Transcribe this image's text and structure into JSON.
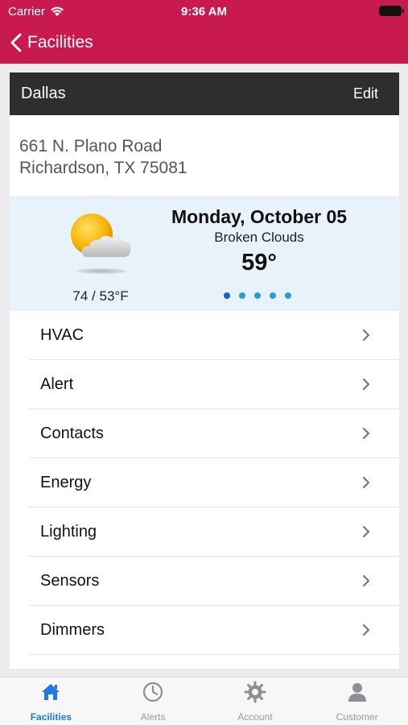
{
  "status_bar": {
    "carrier": "Carrier",
    "time": "9:36 AM"
  },
  "nav": {
    "back_label": "Facilities"
  },
  "facility": {
    "name": "Dallas",
    "edit_label": "Edit",
    "address_line1": "661 N. Plano Road",
    "address_line2": "Richardson, TX 75081"
  },
  "weather": {
    "date": "Monday, October 05",
    "condition": "Broken Clouds",
    "temperature": "59°",
    "high_low": "74 / 53°F",
    "icon": "partly-cloudy-icon",
    "page_count": 5,
    "active_page": 1
  },
  "menu": {
    "items": [
      {
        "label": "HVAC"
      },
      {
        "label": "Alert"
      },
      {
        "label": "Contacts"
      },
      {
        "label": "Energy"
      },
      {
        "label": "Lighting"
      },
      {
        "label": "Sensors"
      },
      {
        "label": "Dimmers"
      }
    ]
  },
  "tabbar": {
    "tabs": [
      {
        "label": "Facilities",
        "icon": "home-icon",
        "active": true
      },
      {
        "label": "Alerts",
        "icon": "clock-icon",
        "active": false
      },
      {
        "label": "Account",
        "icon": "gear-icon",
        "active": false
      },
      {
        "label": "Customer",
        "icon": "person-icon",
        "active": false
      }
    ]
  },
  "colors": {
    "brand": "#c91a4f",
    "header": "#2e2e2e",
    "accent": "#1e78e8",
    "weather_bg": "#e8f2fb"
  }
}
